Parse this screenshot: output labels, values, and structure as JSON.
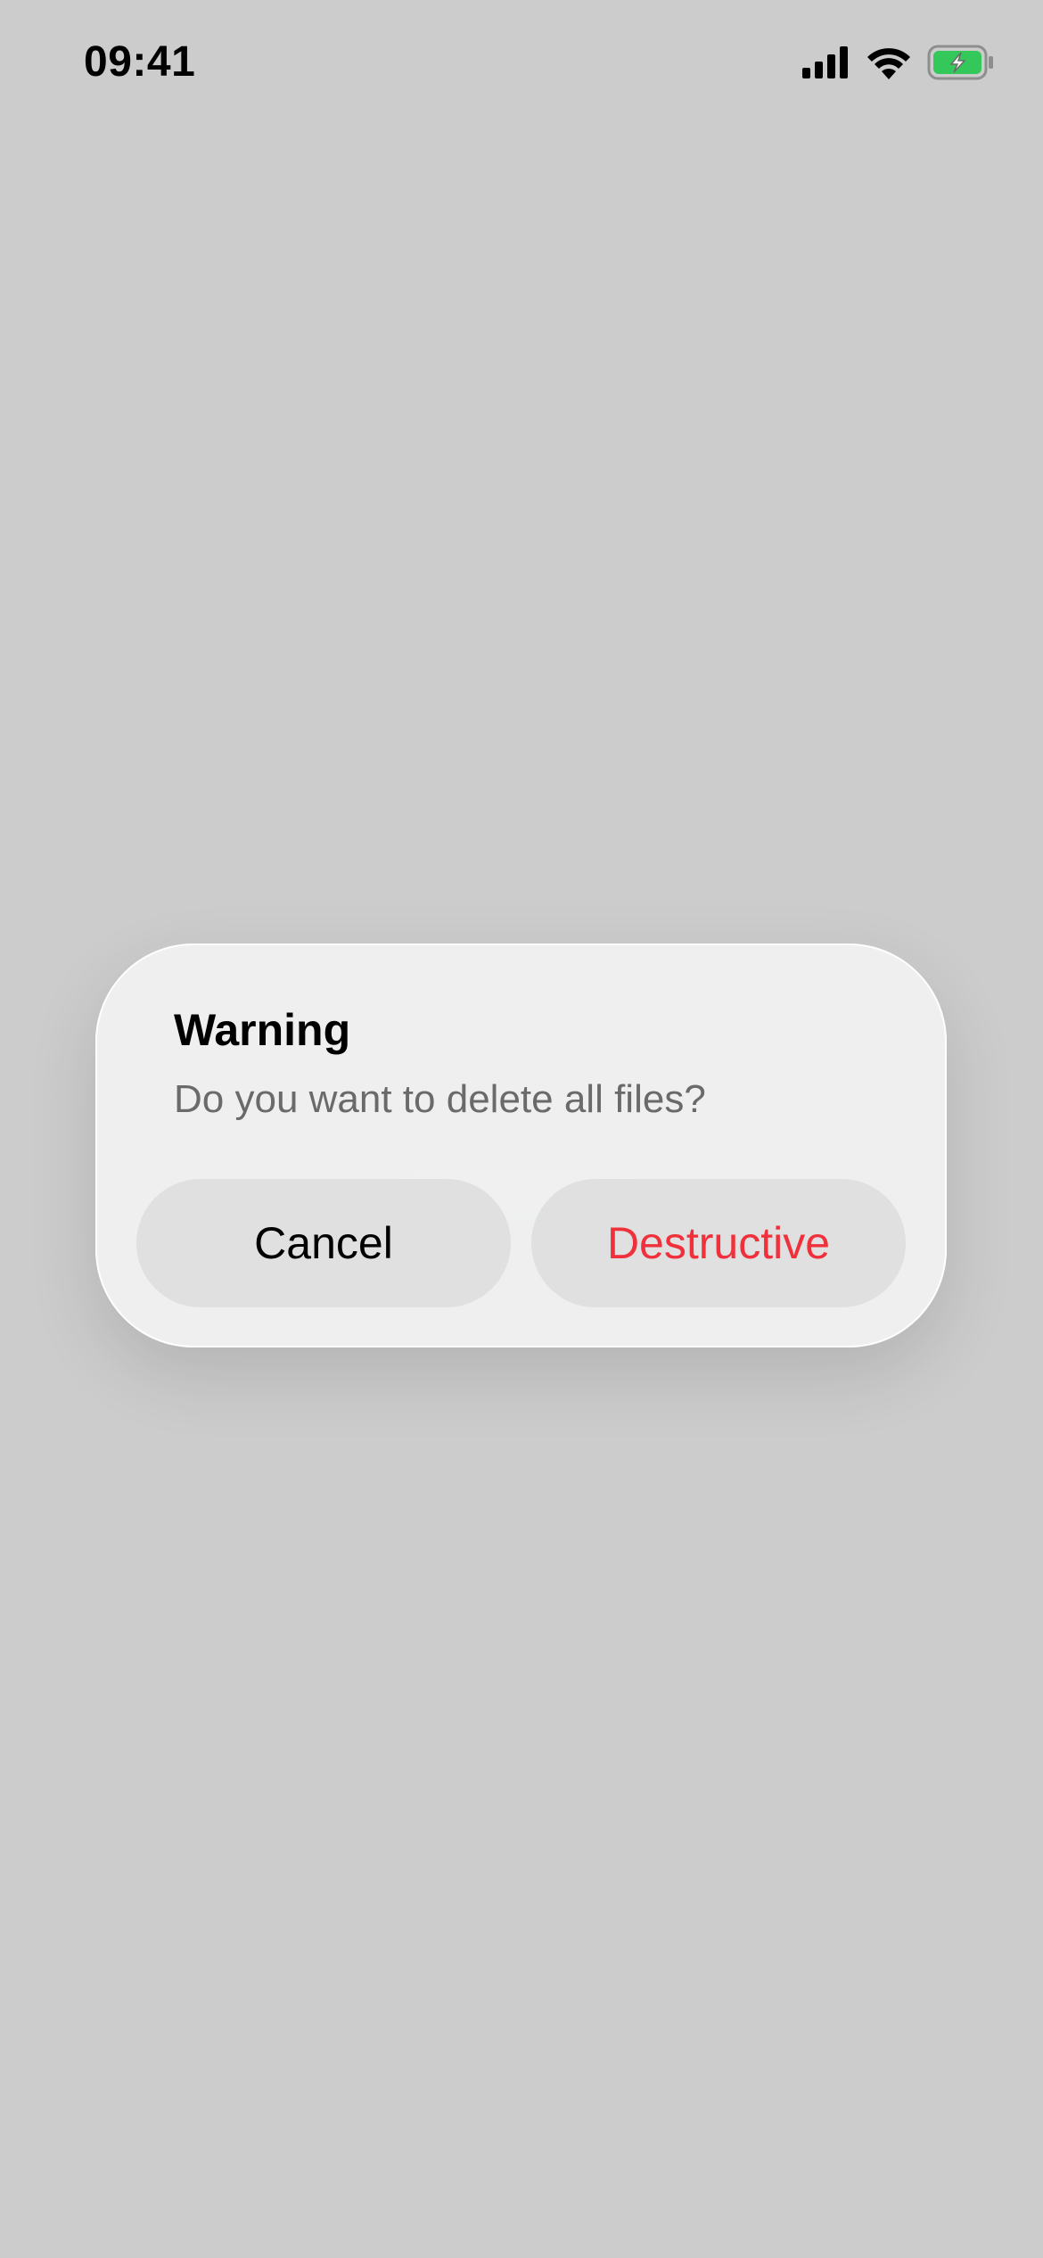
{
  "status_bar": {
    "time": "09:41",
    "icons": [
      "cellular-signal-icon",
      "wifi-icon",
      "battery-charging-icon"
    ],
    "battery_color": "#34c759"
  },
  "alert": {
    "title": "Warning",
    "message": "Do you want to delete all files?",
    "cancel_label": "Cancel",
    "destructive_label": "Destructive",
    "destructive_color": "#f0303a"
  },
  "colors": {
    "background": "#cccccc",
    "dialog": "#f0f0f0",
    "button": "#e0e0e0"
  }
}
